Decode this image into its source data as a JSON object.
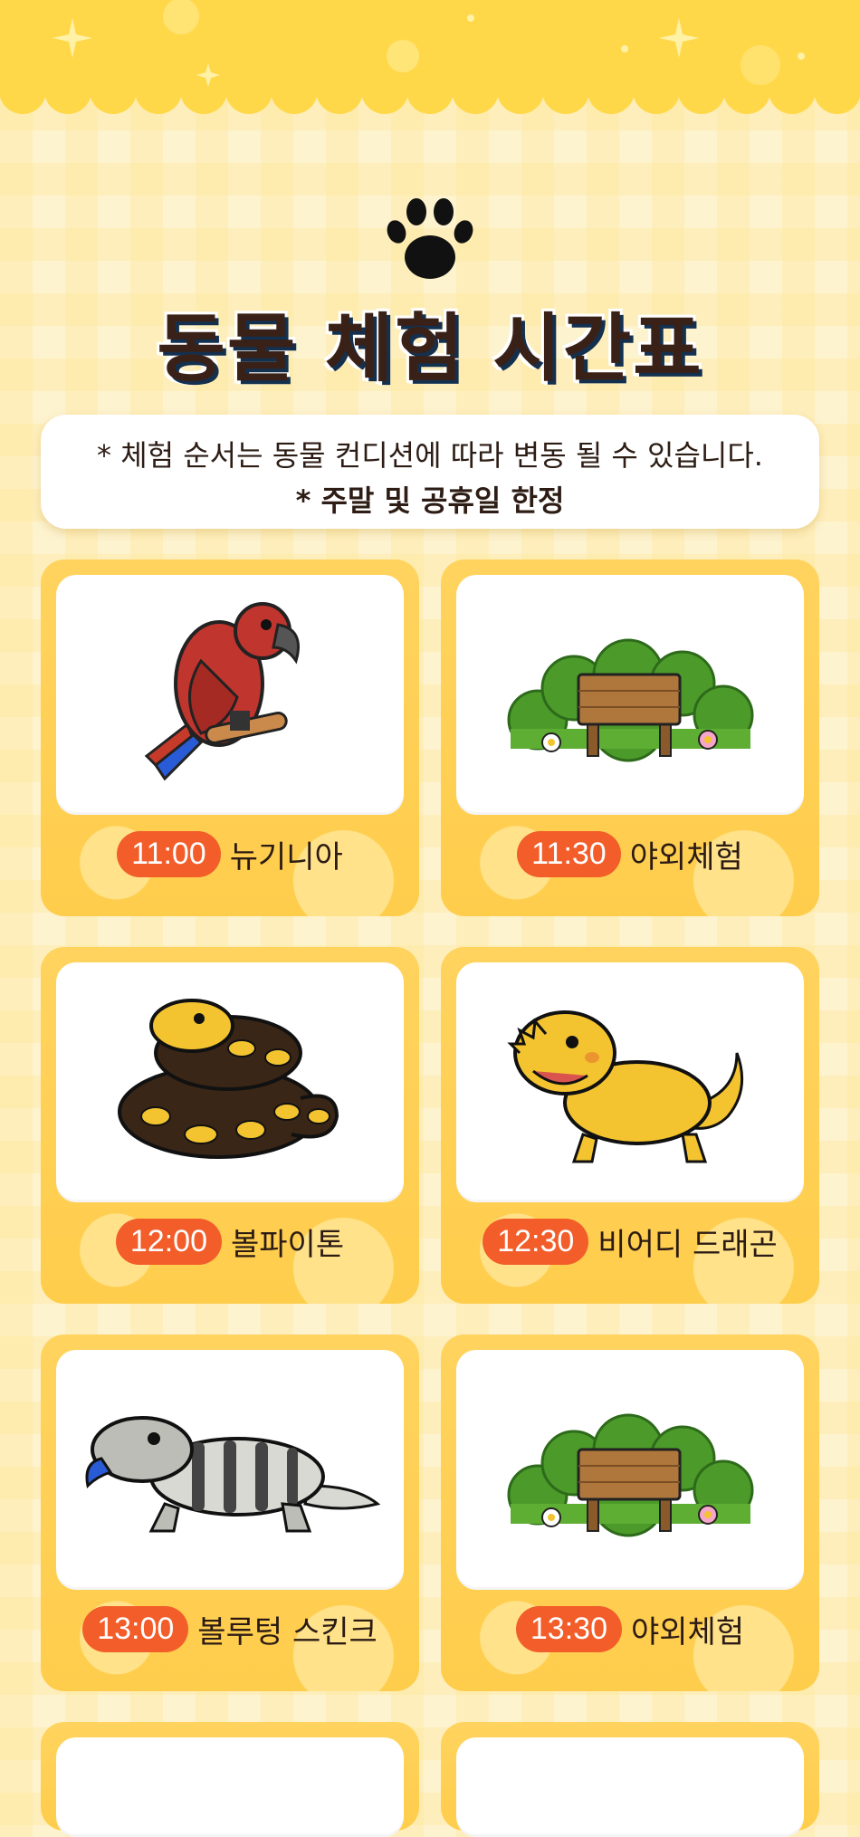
{
  "header": {
    "title": "동물 체험 시간표",
    "notice_line1": "* 체험 순서는 동물 컨디션에 따라 변동 될 수 있습니다.",
    "notice_line2": "* 주말 및 공휴일 한정"
  },
  "schedule": [
    {
      "time": "11:00",
      "name": "뉴기니아",
      "icon": "parrot-icon"
    },
    {
      "time": "11:30",
      "name": "야외체험",
      "icon": "outdoor-sign-icon"
    },
    {
      "time": "12:00",
      "name": "볼파이톤",
      "icon": "ball-python-icon"
    },
    {
      "time": "12:30",
      "name": "비어디 드래곤",
      "icon": "bearded-dragon-icon"
    },
    {
      "time": "13:00",
      "name": "볼루텅 스킨크",
      "icon": "blue-tongue-skink-icon"
    },
    {
      "time": "13:30",
      "name": "야외체험",
      "icon": "outdoor-sign-icon"
    }
  ],
  "colors": {
    "background": "#fdf3cf",
    "banner": "#ffd84a",
    "card": "#ffd35e",
    "time_badge": "#f25d2a",
    "title_text": "#3a2117"
  }
}
